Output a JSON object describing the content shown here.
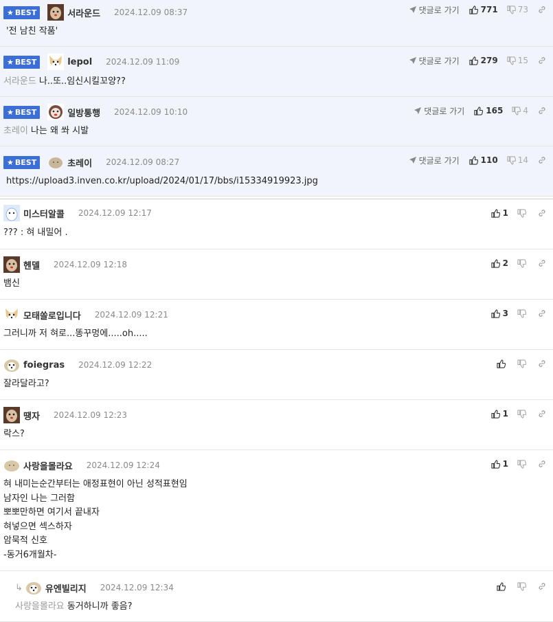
{
  "best_label": "BEST",
  "goto_label": "댓글로 가기",
  "best_comments": [
    {
      "nick": "서라운드",
      "date": "2024.12.09 08:37",
      "mention": "",
      "text": "'전 남친 작품'",
      "up": "771",
      "down": "73"
    },
    {
      "nick": "lepol",
      "date": "2024.12.09 11:09",
      "mention": "서라운드",
      "text": "나..또..임신시킬꼬양??",
      "up": "279",
      "down": "15"
    },
    {
      "nick": "일방통행",
      "date": "2024.12.09 10:10",
      "mention": "초레이",
      "text": "나는 왜 쏴 시발",
      "up": "165",
      "down": "4"
    },
    {
      "nick": "초레이",
      "date": "2024.12.09 08:27",
      "mention": "",
      "text": "https://upload3.inven.co.kr/upload/2024/01/17/bbs/i15334919923.jpg",
      "up": "110",
      "down": "14"
    }
  ],
  "comments": [
    {
      "nick": "미스터알콜",
      "date": "2024.12.09 12:17",
      "mention": "",
      "text": "??? : 혀 내밀어 .",
      "up": "1"
    },
    {
      "nick": "헨델",
      "date": "2024.12.09 12:18",
      "mention": "",
      "text": "뱀신",
      "up": "2"
    },
    {
      "nick": "모태쏠로입니다",
      "date": "2024.12.09 12:21",
      "mention": "",
      "text": "그러니까 저 혀로...똥꾸멍에.....oh.....",
      "up": "3"
    },
    {
      "nick": "foiegras",
      "date": "2024.12.09 12:22",
      "mention": "",
      "text": "잘라달라고?",
      "up": ""
    },
    {
      "nick": "땡자",
      "date": "2024.12.09 12:23",
      "mention": "",
      "text": "락스?",
      "up": "1"
    },
    {
      "nick": "사랑을몰라요",
      "date": "2024.12.09 12:24",
      "mention": "",
      "text": "혀 내미는순간부터는 애정표현이 아닌 성적표현임\n남자인 나는 그러함\n뽀뽀만하면 여기서 끝내자\n혀넣으면 섹스하자\n암묵적 신호\n-동거6개월차-",
      "up": "1"
    }
  ],
  "reply": {
    "nick": "유엔빌리지",
    "date": "2024.12.09 12:34",
    "mention": "사랑을몰라요",
    "text": "동거하니까 좋음?",
    "up": ""
  }
}
